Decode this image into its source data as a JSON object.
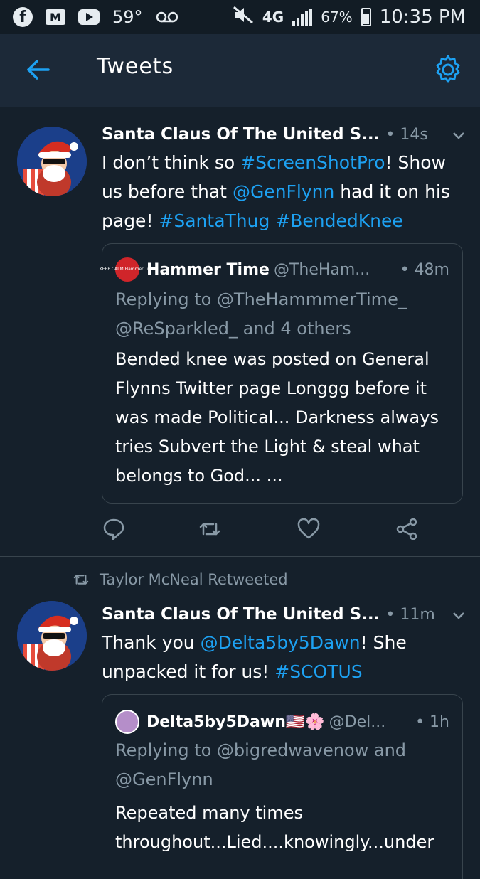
{
  "status_bar": {
    "temperature": "59°",
    "network": "4G",
    "battery_percent": "67%",
    "battery_level": 0.67,
    "time": "10:35 PM"
  },
  "header": {
    "title": "Tweets"
  },
  "colors": {
    "background": "#15202b",
    "header": "#1c2938",
    "accent": "#1da1f2",
    "muted": "#8899a6",
    "border": "#38444d"
  },
  "tweets": [
    {
      "author": "Santa Claus Of The United S...",
      "time": "• 14s",
      "text_parts": [
        {
          "t": "I don’t think so ",
          "link": false
        },
        {
          "t": "#ScreenShotPro",
          "link": true
        },
        {
          "t": "! Show us before that ",
          "link": false
        },
        {
          "t": "@GenFlynn",
          "link": true
        },
        {
          "t": " had it on his page! ",
          "link": false
        },
        {
          "t": "#SantaThug",
          "link": true
        },
        {
          "t": " ",
          "link": false
        },
        {
          "t": "#BendedKnee",
          "link": true
        }
      ],
      "quote": {
        "name": "Hammer Time",
        "handle": "@TheHam...",
        "time": "• 48m",
        "avatar_text": "KEEP CALM Hammer Time",
        "replying": "Replying to @TheHammmerTime_ @ReSparkled_ and 4 others",
        "text": "Bended knee was posted on General Flynns Twitter page Longgg before it was made Political... Darkness always tries Subvert the Light & steal what belongs to God...  ..."
      }
    },
    {
      "retweeted_by": "Taylor McNeal Retweeted",
      "author": "Santa Claus Of The United S...",
      "time": "• 11m",
      "text_parts": [
        {
          "t": "Thank you ",
          "link": false
        },
        {
          "t": "@Delta5by5Dawn",
          "link": true
        },
        {
          "t": "! She unpacked it for us! ",
          "link": false
        },
        {
          "t": "#SCOTUS",
          "link": true
        }
      ],
      "quote": {
        "name": "Delta5by5Dawn🇺🇸🌸",
        "handle": "@Del...",
        "time": "• 1h",
        "replying": "Replying to @bigredwavenow and @GenFlynn",
        "text": "Repeated many times throughout...Lied....knowingly...under"
      }
    }
  ]
}
